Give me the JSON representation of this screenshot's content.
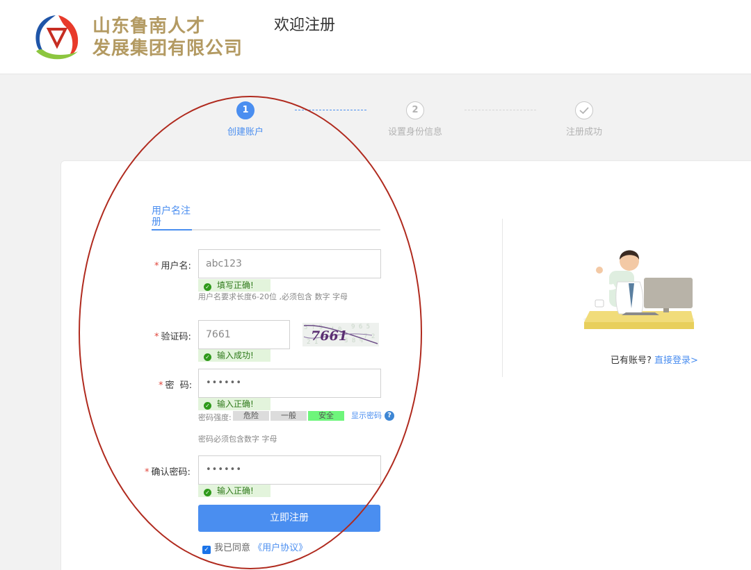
{
  "header": {
    "company_line1": "山东鲁南人才",
    "company_line2": "发展集团有限公司",
    "page_title": "欢迎注册"
  },
  "steps": [
    {
      "number": "1",
      "label": "创建账户",
      "state": "active"
    },
    {
      "number": "2",
      "label": "设置身份信息",
      "state": "todo"
    },
    {
      "icon": "check-icon",
      "label": "注册成功",
      "state": "todo"
    }
  ],
  "tab": {
    "label": "用户名注册"
  },
  "form": {
    "required_mark": "*",
    "username": {
      "label": "用户名:",
      "value": "abc123",
      "status": "填写正确!",
      "hint": "用户名要求长度6-20位 ,必须包含 数字 字母"
    },
    "captcha": {
      "label": "验证码:",
      "value": "7661",
      "status": "输入成功!",
      "image_text": "7661"
    },
    "password": {
      "label": "密  码:",
      "value": "••••••",
      "status": "输入正确!",
      "strength_label": "密码强度:",
      "strength_levels": [
        "危险",
        "一般",
        "安全"
      ],
      "active_level": "安全",
      "show_password": "显示密码",
      "hint": "密码必须包含数字 字母"
    },
    "confirm_password": {
      "label": "确认密码:",
      "value": "••••••",
      "status": "输入正确!"
    },
    "submit": "立即注册",
    "agree_text": "我已同意",
    "agreement_link": "《用户协议》",
    "agree_checked": true
  },
  "side": {
    "login_prompt": "已有账号?",
    "login_link": "直接登录>"
  },
  "colors": {
    "accent": "#4a8ef0",
    "success_bg": "#e3f4dc",
    "success_text": "#2f7a1b",
    "brand_gold": "#b39a62",
    "annotation_red": "#b02a1e",
    "strength_safe": "#6ef57b"
  }
}
